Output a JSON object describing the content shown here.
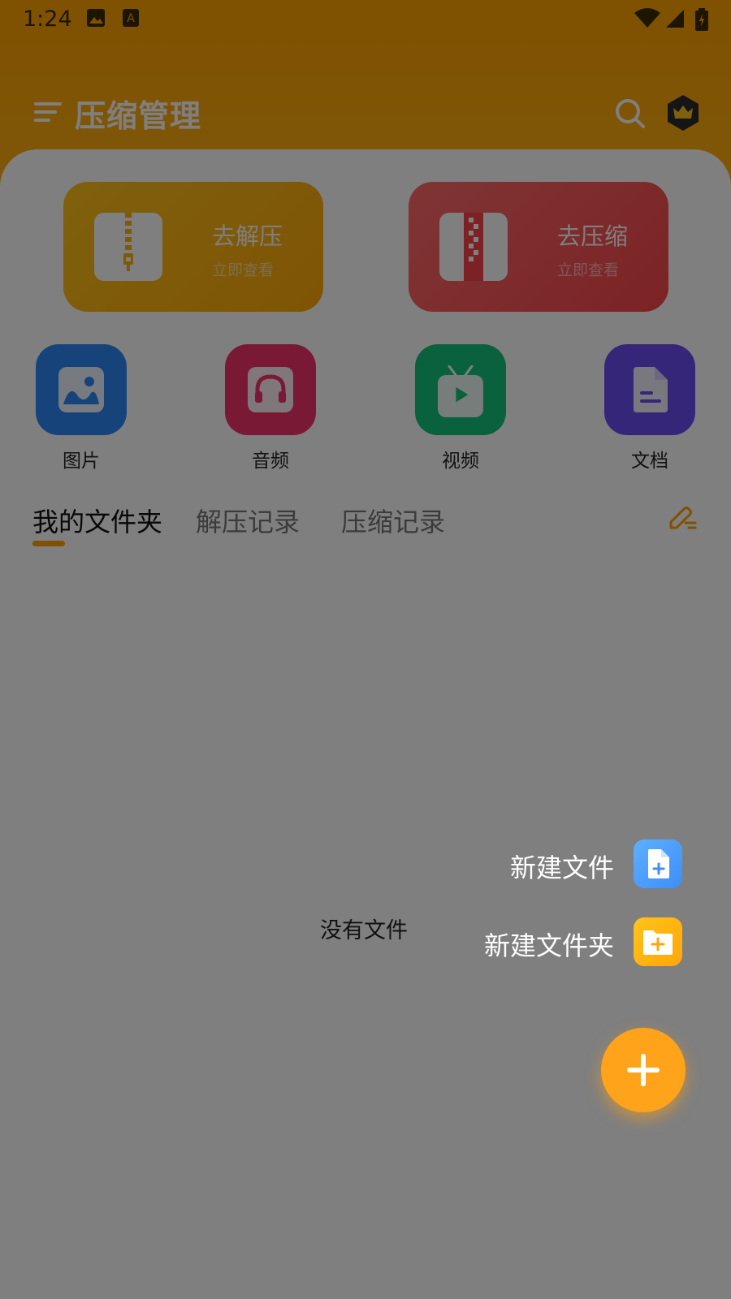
{
  "status_bar": {
    "time": "1:24"
  },
  "app_bar": {
    "title": "压缩管理"
  },
  "cards": [
    {
      "title": "去解压",
      "subtitle": "立即查看"
    },
    {
      "title": "去压缩",
      "subtitle": "立即查看"
    }
  ],
  "categories": [
    {
      "label": "图片",
      "color": "#2F86F6"
    },
    {
      "label": "音频",
      "color": "#F5336A"
    },
    {
      "label": "视频",
      "color": "#13C27C"
    },
    {
      "label": "文档",
      "color": "#6A4CF5"
    }
  ],
  "tabs": [
    {
      "label": "我的文件夹",
      "active": true
    },
    {
      "label": "解压记录",
      "active": false
    },
    {
      "label": "压缩记录",
      "active": false
    }
  ],
  "empty_state": {
    "text": "没有文件"
  },
  "fab_menu": {
    "new_file_label": "新建文件",
    "new_folder_label": "新建文件夹"
  },
  "colors": {
    "accent": "#FFA300",
    "decompress_card": "#FFB010",
    "compress_card": "#F8454A",
    "overlay": "rgba(0,0,0,0.5)"
  }
}
